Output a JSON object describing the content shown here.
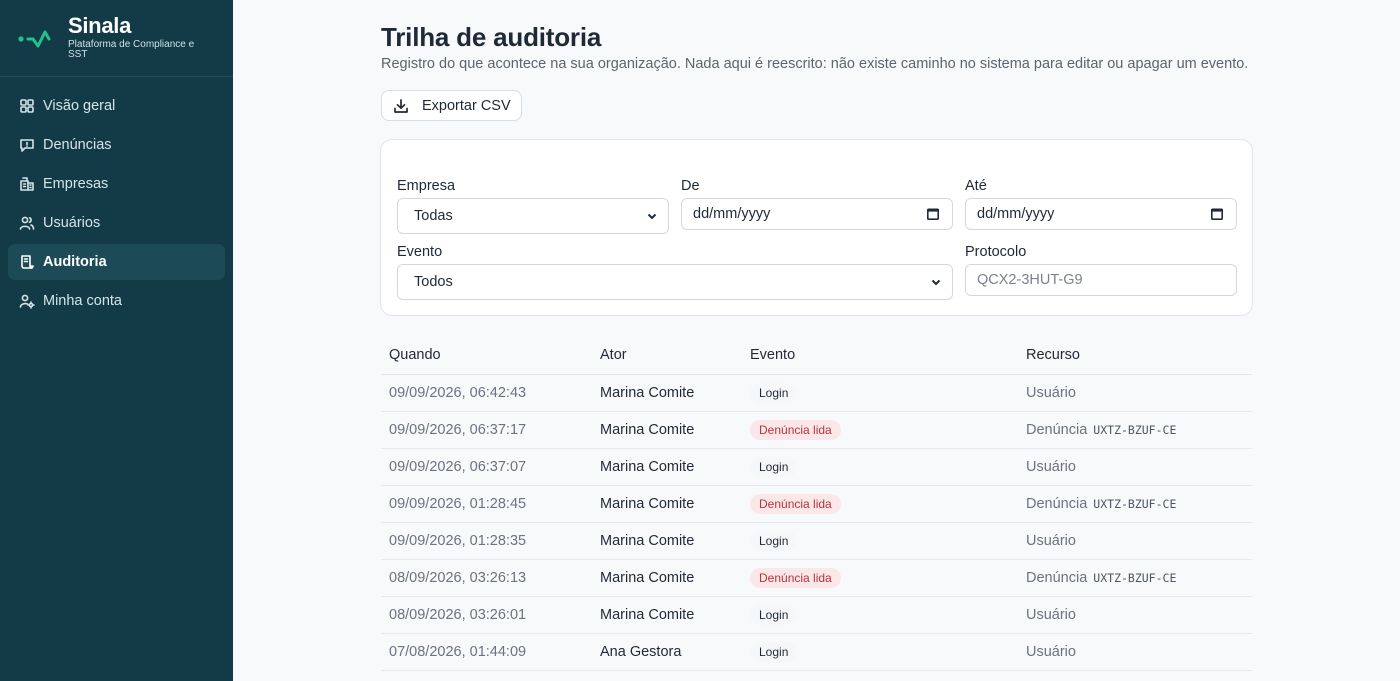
{
  "brand": {
    "name": "Sinala",
    "subtitle": "Plataforma de Compliance e SST",
    "accent": "#22c28a"
  },
  "nav": [
    {
      "label": "Visão geral",
      "icon": "grid-icon",
      "active": false
    },
    {
      "label": "Denúncias",
      "icon": "message-square-icon",
      "active": false
    },
    {
      "label": "Empresas",
      "icon": "building-icon",
      "active": false
    },
    {
      "label": "Usuários",
      "icon": "users-icon",
      "active": false
    },
    {
      "label": "Auditoria",
      "icon": "scroll-icon",
      "active": true
    },
    {
      "label": "Minha conta",
      "icon": "user-cog-icon",
      "active": false
    }
  ],
  "page": {
    "title": "Trilha de auditoria",
    "subtitle": "Registro do que acontece na sua organização. Nada aqui é reescrito: não existe caminho no sistema para editar ou apagar um evento."
  },
  "toolbar": {
    "export_label": "Exportar CSV"
  },
  "filters": {
    "empresa": {
      "label": "Empresa",
      "value": "Todas"
    },
    "de": {
      "label": "De",
      "value": "dd/mm/yyyy"
    },
    "ate": {
      "label": "Até",
      "value": "dd/mm/yyyy"
    },
    "evento": {
      "label": "Evento",
      "value": "Todos"
    },
    "protocolo": {
      "label": "Protocolo",
      "placeholder": "QCX2-3HUT-G9"
    }
  },
  "table": {
    "headers": [
      "Quando",
      "Ator",
      "Evento",
      "Recurso"
    ],
    "rows": [
      {
        "when": "09/09/2026, 06:42:43",
        "actor": "Marina Comite",
        "event": "Login",
        "event_type": "login",
        "resource": "Usuário",
        "code": ""
      },
      {
        "when": "09/09/2026, 06:37:17",
        "actor": "Marina Comite",
        "event": "Denúncia lida",
        "event_type": "read",
        "resource": "Denúncia",
        "code": "UXTZ-BZUF-CE"
      },
      {
        "when": "09/09/2026, 06:37:07",
        "actor": "Marina Comite",
        "event": "Login",
        "event_type": "login",
        "resource": "Usuário",
        "code": ""
      },
      {
        "when": "09/09/2026, 01:28:45",
        "actor": "Marina Comite",
        "event": "Denúncia lida",
        "event_type": "read",
        "resource": "Denúncia",
        "code": "UXTZ-BZUF-CE"
      },
      {
        "when": "09/09/2026, 01:28:35",
        "actor": "Marina Comite",
        "event": "Login",
        "event_type": "login",
        "resource": "Usuário",
        "code": ""
      },
      {
        "when": "08/09/2026, 03:26:13",
        "actor": "Marina Comite",
        "event": "Denúncia lida",
        "event_type": "read",
        "resource": "Denúncia",
        "code": "UXTZ-BZUF-CE"
      },
      {
        "when": "08/09/2026, 03:26:01",
        "actor": "Marina Comite",
        "event": "Login",
        "event_type": "login",
        "resource": "Usuário",
        "code": ""
      },
      {
        "when": "07/08/2026, 01:44:09",
        "actor": "Ana Gestora",
        "event": "Login",
        "event_type": "login",
        "resource": "Usuário",
        "code": ""
      }
    ]
  }
}
